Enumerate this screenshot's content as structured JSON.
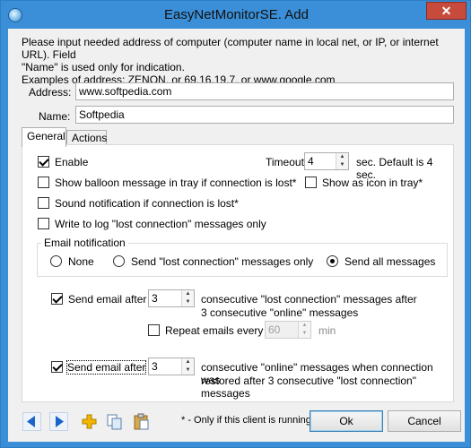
{
  "window": {
    "title": "EasyNetMonitorSE. Add",
    "close_glyph": "✕"
  },
  "intro": {
    "line1": "Please input needed address of computer (computer name in local net, or IP, or internet URL). Field",
    "line2": "\"Name\" is used only for indication.",
    "line3": "Examples of address:   ZENON, or   69.16.19.7,  or www.google.com"
  },
  "fields": {
    "address_label": "Address:",
    "address_value": "www.softpedia.com",
    "name_label": "Name:",
    "name_value": "Softpedia"
  },
  "tabs": [
    {
      "label": "General",
      "active": true
    },
    {
      "label": "Actions",
      "active": false
    }
  ],
  "general": {
    "enable_label": "Enable",
    "enable_checked": true,
    "timeout_label": "Timeout:",
    "timeout_value": "4",
    "timeout_hint": "sec. Default is 4 sec.",
    "balloon_label": "Show balloon message in tray if connection is lost*",
    "balloon_checked": false,
    "tray_icon_label": "Show as icon in tray*",
    "tray_icon_checked": false,
    "sound_label": "Sound notification if connection is lost*",
    "sound_checked": false,
    "log_label": "Write to log \"lost connection\" messages only",
    "log_checked": false
  },
  "email": {
    "group_title": "Email notification",
    "options": [
      {
        "label": "None",
        "selected": false
      },
      {
        "label": "Send \"lost connection\" messages only",
        "selected": false
      },
      {
        "label": "Send all messages",
        "selected": true
      }
    ],
    "send1_label": "Send email after",
    "send1_checked": true,
    "send1_value": "3",
    "send1_text_a": "consecutive \"lost connection\" messages after",
    "send1_text_b": "3 consecutive \"online\" messages",
    "repeat_label": "Repeat emails every",
    "repeat_checked": false,
    "repeat_value": "60",
    "repeat_unit": "min",
    "send2_label": "Send email after",
    "send2_checked": true,
    "send2_value": "3",
    "send2_text_a": "consecutive \"online\" messages when connection was",
    "send2_text_b": "restored after   3 consecutive \"lost connection\" messages"
  },
  "footer": {
    "note": "* - Only if this client is running",
    "ok_label": "Ok",
    "cancel_label": "Cancel",
    "icons": [
      "arrow-left-icon",
      "arrow-right-icon",
      "add-icon",
      "copy-icon",
      "paste-icon"
    ]
  },
  "colors": {
    "frame": "#3b8fd8",
    "close": "#c74b3c",
    "nav_arrow": "#1a63c7",
    "add_icon": "#f2b600"
  }
}
